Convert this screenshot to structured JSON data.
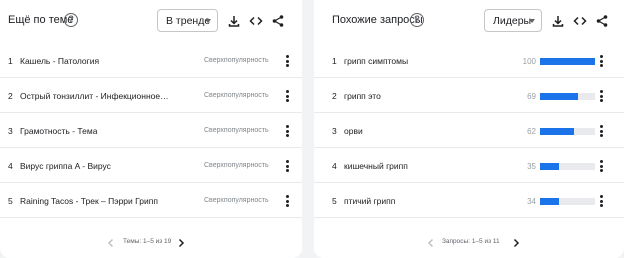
{
  "topics_panel": {
    "title": "Ещё по теме",
    "help_icon": "help-circle-icon",
    "filter": {
      "selected": "В тренде"
    },
    "icons": [
      "download-icon",
      "embed-code-icon",
      "share-icon"
    ],
    "rows": [
      {
        "rank": "1",
        "label": "Кашель - Патология",
        "status": "Сверхпопулярность"
      },
      {
        "rank": "2",
        "label": "Острый тонзиллит - Инфекционное забо…",
        "status": "Сверхпопулярность"
      },
      {
        "rank": "3",
        "label": "Грамотность - Тема",
        "status": "Сверхпопулярность"
      },
      {
        "rank": "4",
        "label": "Вирус гриппа A - Вирус",
        "status": "Сверхпопулярность"
      },
      {
        "rank": "5",
        "label": "Raining Tacos - Трек – Пэрри Грипп",
        "status": "Сверхпопулярность"
      }
    ],
    "pagination": "Темы: 1–5 из 19"
  },
  "queries_panel": {
    "title": "Похожие запросы",
    "help_icon": "help-circle-icon",
    "filter": {
      "selected": "Лидеры"
    },
    "icons": [
      "download-icon",
      "embed-code-icon",
      "share-icon"
    ],
    "rows": [
      {
        "rank": "1",
        "label": "грипп симптомы",
        "value": 100
      },
      {
        "rank": "2",
        "label": "грипп это",
        "value": 69
      },
      {
        "rank": "3",
        "label": "орви",
        "value": 62
      },
      {
        "rank": "4",
        "label": "кишечный грипп",
        "value": 35
      },
      {
        "rank": "5",
        "label": "птичий грипп",
        "value": 34
      }
    ],
    "pagination": "Запросы: 1–5 из 11"
  },
  "colors": {
    "bar": "#1a73e8",
    "bar_track": "#e8eaed",
    "page_bg": "#f1f3f4"
  }
}
